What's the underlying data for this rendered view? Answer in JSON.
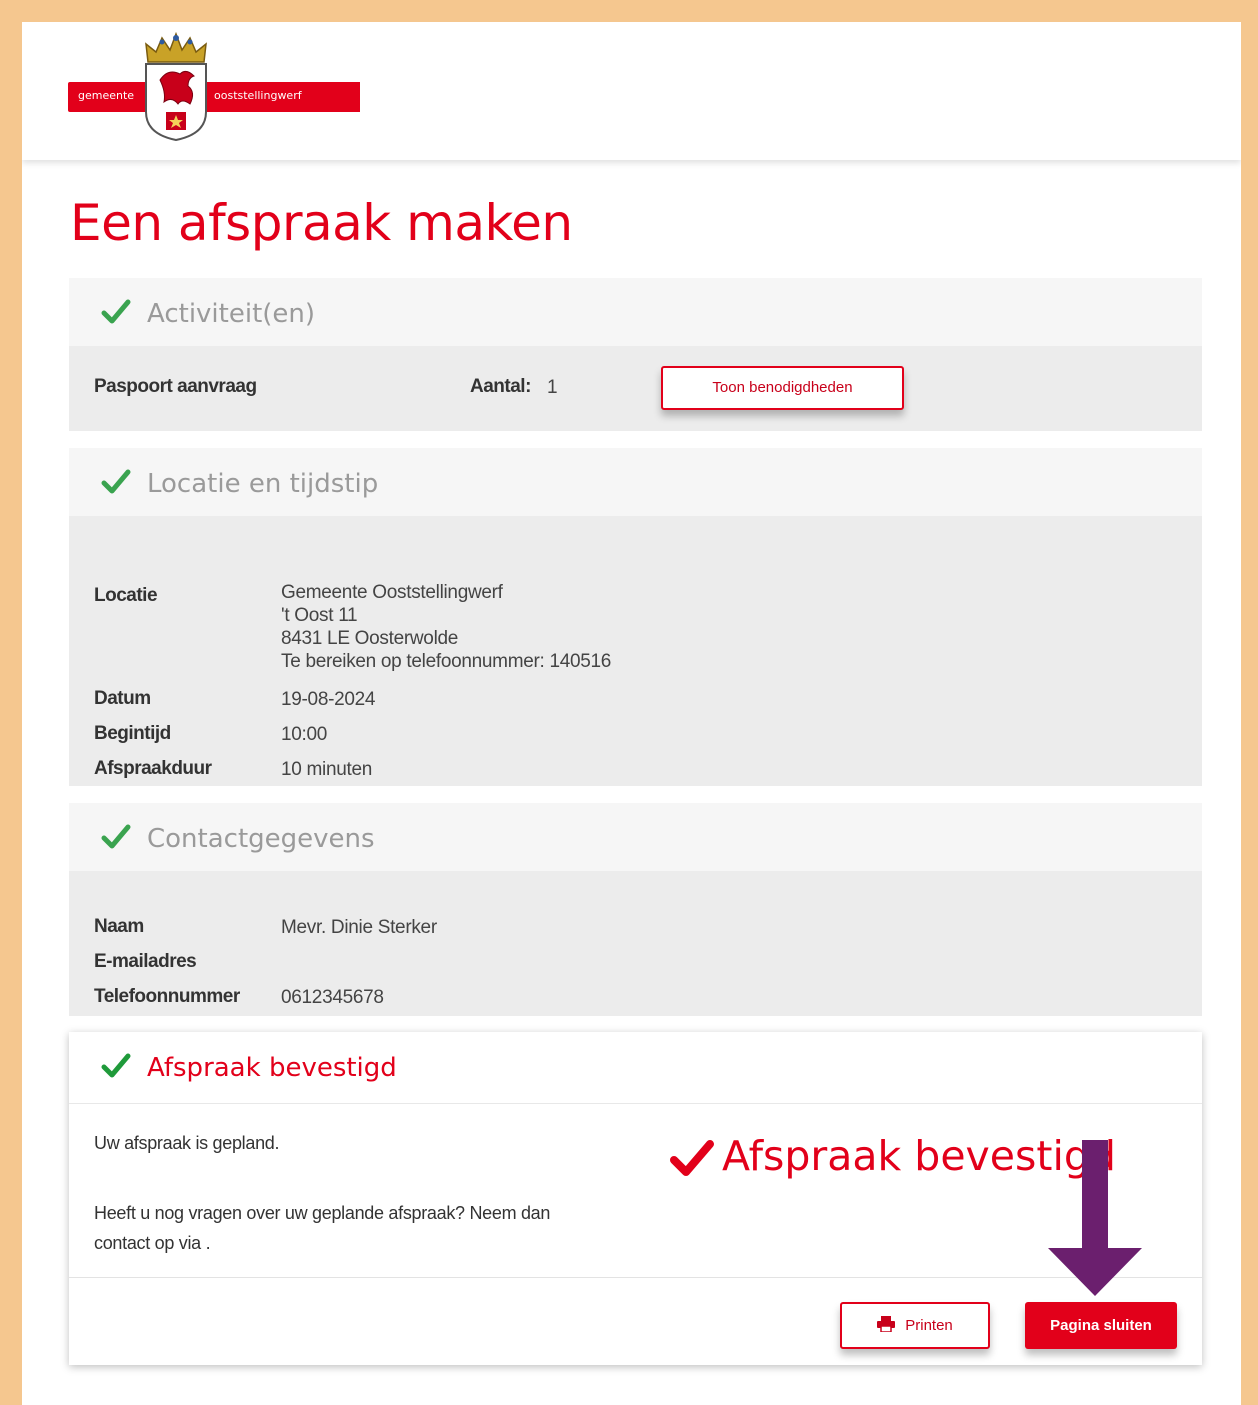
{
  "header": {
    "logo_left": "gemeente",
    "logo_right": "ooststellingwerf"
  },
  "page_title": "Een afspraak maken",
  "activities": {
    "title": "Activiteit(en)",
    "item_name": "Paspoort aanvraag",
    "count_label": "Aantal:",
    "count_value": "1",
    "requirements_button": "Toon benodigdheden"
  },
  "location": {
    "title": "Locatie en tijdstip",
    "location_label": "Locatie",
    "address_line1": "Gemeente Ooststellingwerf",
    "address_line2": "'t Oost 11",
    "address_line3": "8431 LE Oosterwolde",
    "address_line4": "Te bereiken op telefoonnummer: 140516",
    "date_label": "Datum",
    "date_value": "19-08-2024",
    "start_label": "Begintijd",
    "start_value": "10:00",
    "duration_label": "Afspraakduur",
    "duration_value": "10 minuten"
  },
  "contact": {
    "title": "Contactgegevens",
    "name_label": "Naam",
    "name_value": "Mevr. Dinie Sterker",
    "email_label": "E-mailadres",
    "email_value": "",
    "phone_label": "Telefoonnummer",
    "phone_value": "0612345678"
  },
  "confirmation": {
    "title": "Afspraak bevestigd",
    "message1": "Uw afspraak is gepland.",
    "message2_line1": "Heeft u nog vragen over uw geplande afspraak? Neem dan",
    "message2_line2": "contact op via .",
    "print_button": "Printen",
    "close_button": "Pagina sluiten"
  },
  "annotation": {
    "text": "Afspraak bevestigd"
  },
  "colors": {
    "brand_red": "#e2001a",
    "check_green": "#3aa34f",
    "arrow_purple": "#6b1f6e",
    "frame_orange": "#f5c78f"
  }
}
